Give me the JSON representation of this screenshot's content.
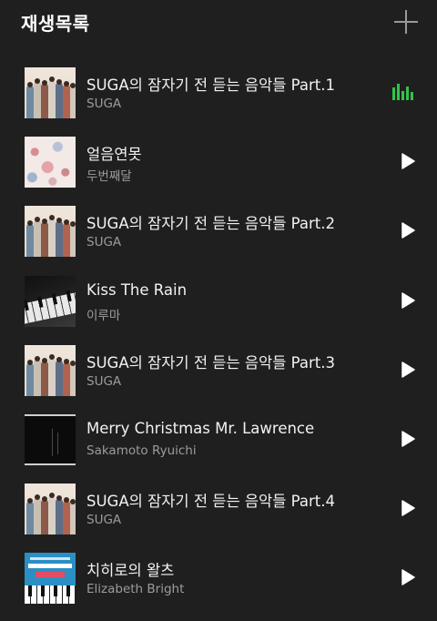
{
  "header": {
    "title": "재생목록"
  },
  "tracks": [
    {
      "title": "SUGA의 잠자기 전 듣는 음악들 Part.1",
      "artist": "SUGA",
      "state": "playing",
      "art": "group-photo"
    },
    {
      "title": "얼음연못",
      "artist": "두번째달",
      "state": "paused",
      "art": "floral-pattern"
    },
    {
      "title": "SUGA의 잠자기 전 듣는 음악들 Part.2",
      "artist": "SUGA",
      "state": "paused",
      "art": "group-photo"
    },
    {
      "title": "Kiss The Rain",
      "artist": "이루마",
      "state": "paused",
      "art": "piano-keys"
    },
    {
      "title": "SUGA의 잠자기 전 듣는 음악들 Part.3",
      "artist": "SUGA",
      "state": "paused",
      "art": "group-photo"
    },
    {
      "title": "Merry Christmas Mr. Lawrence",
      "artist": "Sakamoto Ryuichi",
      "state": "paused",
      "art": "dark-cover"
    },
    {
      "title": "SUGA의 잠자기 전 듣는 음악들 Part.4",
      "artist": "SUGA",
      "state": "paused",
      "art": "group-photo"
    },
    {
      "title": "치히로의 왈츠",
      "artist": "Elizabeth Bright",
      "state": "paused",
      "art": "blue-piano-cover"
    }
  ],
  "colors": {
    "background": "#1f1f1f",
    "accent_playing": "#2fc44a",
    "title_text": "#f2f2f2",
    "artist_text": "#9c9c9c"
  },
  "icons": {
    "add": "plus-icon",
    "play": "play-icon",
    "now_playing": "equalizer-icon"
  }
}
